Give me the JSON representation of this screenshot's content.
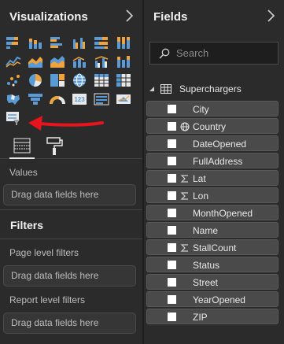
{
  "visualizations": {
    "title": "Visualizations",
    "icons": [
      "stacked-bar-icon",
      "stacked-column-icon",
      "clustered-bar-icon",
      "clustered-column-icon",
      "100-bar-icon",
      "100-column-icon",
      "line-chart-icon",
      "area-chart-icon",
      "stacked-area-icon",
      "line-column-combo-icon",
      "line-clustered-combo-icon",
      "ribbon-chart-icon",
      "scatter-chart-icon",
      "pie-chart-icon",
      "treemap-icon",
      "globe-map-icon",
      "table-icon",
      "matrix-icon",
      "filled-map-icon",
      "funnel-icon",
      "gauge-icon",
      "card-icon",
      "multi-row-card-icon",
      "kpi-icon",
      "slicer-icon"
    ],
    "values_label": "Values",
    "values_drop": "Drag data fields here"
  },
  "filters": {
    "title": "Filters",
    "page_label": "Page level filters",
    "page_drop": "Drag data fields here",
    "report_label": "Report level filters",
    "report_drop": "Drag data fields here"
  },
  "fields": {
    "title": "Fields",
    "search_placeholder": "Search",
    "table_name": "Superchargers",
    "items": [
      {
        "label": "City",
        "icon": ""
      },
      {
        "label": "Country",
        "icon": "globe"
      },
      {
        "label": "DateOpened",
        "icon": ""
      },
      {
        "label": "FullAddress",
        "icon": ""
      },
      {
        "label": "Lat",
        "icon": "sigma"
      },
      {
        "label": "Lon",
        "icon": "sigma"
      },
      {
        "label": "MonthOpened",
        "icon": ""
      },
      {
        "label": "Name",
        "icon": ""
      },
      {
        "label": "StallCount",
        "icon": "sigma"
      },
      {
        "label": "Status",
        "icon": ""
      },
      {
        "label": "Street",
        "icon": ""
      },
      {
        "label": "YearOpened",
        "icon": ""
      },
      {
        "label": "ZIP",
        "icon": ""
      }
    ]
  },
  "colors": {
    "background": "#2b2b2b",
    "arrow": "#e8141d",
    "field_bg": "#4a4a4a"
  }
}
